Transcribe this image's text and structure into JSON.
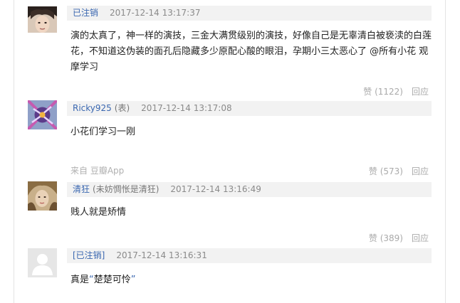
{
  "comments": [
    {
      "username": "已注销",
      "flair": "",
      "time": "2017-12-14 13:17:37",
      "text": "演的太真了，神一样的演技，三金大满贯级别的演技，好像自己是无辜清白被亵渎的白莲花，不知道这伪装的面孔后隐藏多少原配心酸的眼泪，孕期小三太恶心了 @所有小花 观摩学习",
      "likes": "赞 (1122)",
      "reply": "回应",
      "avatar_icon": "user-avatar-photo"
    },
    {
      "username": "Ricky925",
      "flair": "(表)",
      "time": "2017-12-14 13:17:08",
      "text": "小花们学习一刚",
      "source": "来自 豆瓣App",
      "likes": "赞 (573)",
      "reply": "回应",
      "avatar_icon": "user-avatar-illustration"
    },
    {
      "username": "清狂",
      "flair": "(未妨惆怅是清狂)",
      "time": "2017-12-14 13:16:49",
      "text": "贱人就是矫情",
      "likes": "赞 (389)",
      "reply": "回应",
      "avatar_icon": "user-avatar-photo"
    },
    {
      "username": "[已注销]",
      "flair": "",
      "time": "2017-12-14 13:16:31",
      "text_prefix": "真是",
      "quote_open": "“",
      "text_quoted": "楚楚可怜",
      "quote_close": "”",
      "avatar_icon": "default-avatar-icon"
    }
  ],
  "colors": {
    "link": "#3a67b0",
    "header_bg": "#f2f2f2",
    "muted": "#aaaaaa"
  }
}
